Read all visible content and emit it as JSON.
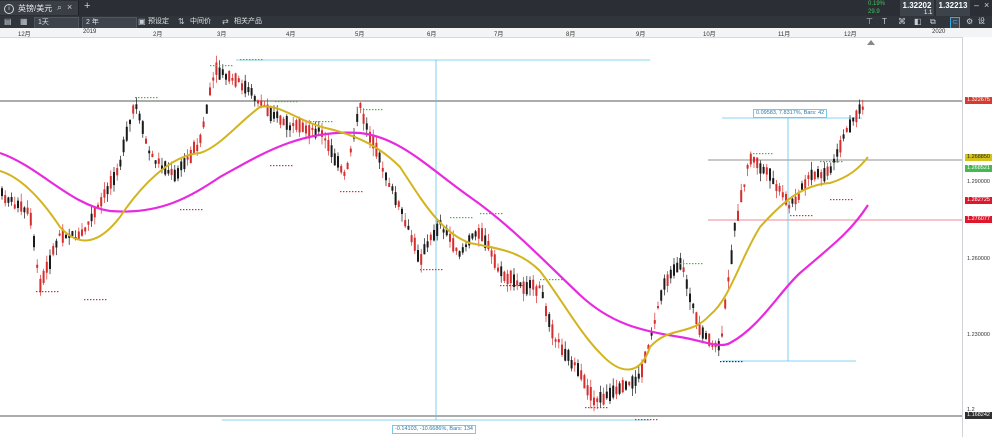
{
  "tab": {
    "icon": "i",
    "label": "英镑/美元"
  },
  "quote": {
    "change_pct": "0.19%",
    "change_pts": "29.9",
    "bid": "1.32202",
    "ask": "1.32213",
    "spread": "1.1"
  },
  "toolbar": {
    "interval": "1天",
    "range": "2 年",
    "preset": "预设定",
    "midprice": "中间价",
    "related": "相关产品",
    "settings": "设"
  },
  "axis_months": [
    "12月",
    "2019",
    "2月",
    "3月",
    "4月",
    "5月",
    "6月",
    "7月",
    "8月",
    "9月",
    "10月",
    "11月",
    "12月",
    "2020"
  ],
  "price_ticks": [
    "1.290000",
    "1.260000",
    "1.230000",
    "1.2"
  ],
  "price_tags": [
    {
      "text": "1.322675",
      "color": "#d63b2f"
    },
    {
      "text": "1.268850",
      "color": "#d4c21c"
    },
    {
      "text": "1.268521",
      "color": "#44b94d"
    },
    {
      "text": "1.282725",
      "color": "#e0162c"
    },
    {
      "text": "1.276077",
      "color": "#e0162c"
    },
    {
      "text": "1.168242",
      "color": "#303030"
    }
  ],
  "measures": {
    "upper": "0.09583, 7.8317%, Bars: 42",
    "lower": "-0.14103, -10.6686%, Bars: 134"
  },
  "colors": {
    "up": "#1a1a1a",
    "down": "#d62d2d",
    "ma_short": "#d3b41e",
    "ma_long": "#e82adf",
    "guide": "#5bc6ee"
  }
}
